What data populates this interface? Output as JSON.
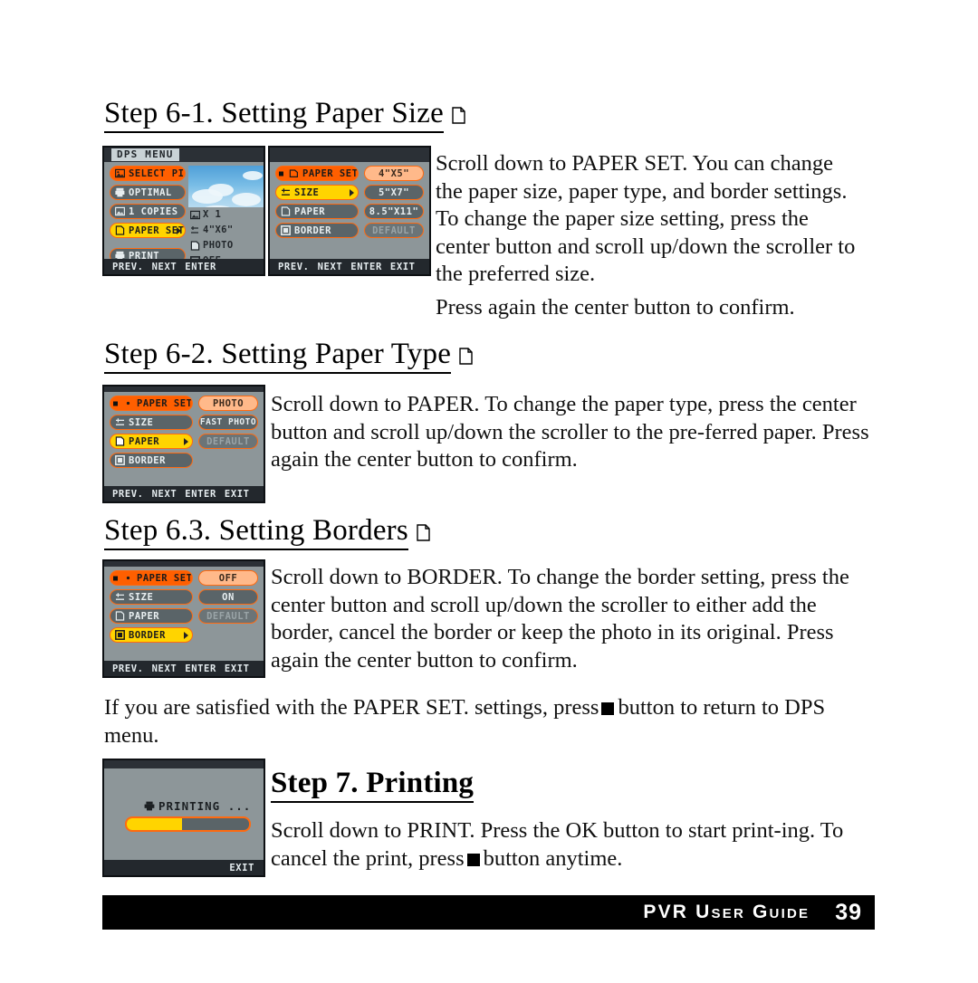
{
  "document": {
    "page_number": "39",
    "footer_label": "PVR User Guide"
  },
  "sections": [
    {
      "heading": "Step 6-1. Setting Paper Size",
      "body": "Scroll down to PAPER SET. You can change the paper size, paper type, and border settings. To change the paper size setting, press the center button and scroll up/down the scroller to the preferred size.",
      "body2": "Press again the center button to confirm."
    },
    {
      "heading": "Step 6-2. Setting Paper Type",
      "body": "Scroll down to PAPER. To change the paper type, press the center button and scroll up/down the scroller to the pre-ferred paper. Press again the center button to confirm."
    },
    {
      "heading": "Step 6.3. Setting Borders",
      "body": "Scroll down to BORDER. To change the border setting, press the center button and scroll up/down the scroller to either add the border, cancel the border or keep the photo in its original. Press again the center button to confirm."
    },
    {
      "heading": "Step 7. Printing",
      "body_pre": "Scroll down to PRINT. Press the OK button to start print-ing. To cancel the print, press",
      "body_post": "button anytime."
    }
  ],
  "interstitial": {
    "pre": "If you are satisfied with the PAPER SET. settings, press",
    "post": "button to return to DPS menu."
  },
  "lcd_footbar": {
    "prev": "PREV.",
    "next": "NEXT",
    "enter": "ENTER",
    "exit": "EXIT"
  },
  "lcd1": {
    "title": "DPS MENU",
    "menu": [
      {
        "label": "SELECT PIC",
        "state": "orange",
        "icon": "picture-icon"
      },
      {
        "label": "OPTIMAL",
        "state": "gray",
        "icon": "printer-icon"
      },
      {
        "label": "1 COPIES",
        "state": "gray",
        "icon": "copies-icon"
      },
      {
        "label": "PAPER SET.",
        "state": "yellow",
        "icon": "paper-icon"
      }
    ],
    "print_button": {
      "label": "PRINT",
      "icon": "printer-icon"
    },
    "info": [
      {
        "label": "X 1",
        "icon": "picture-icon"
      },
      {
        "label": "4\"X6\"",
        "icon": "size-icon"
      },
      {
        "label": "PHOTO",
        "icon": "paper-icon"
      },
      {
        "label": "OFF",
        "icon": "border-icon"
      }
    ]
  },
  "lcd2": {
    "menu": [
      {
        "label": "PAPER SET.",
        "state": "orange",
        "icon": "back-icon"
      },
      {
        "label": "SIZE",
        "state": "yellow",
        "icon": "size-icon"
      },
      {
        "label": "PAPER",
        "state": "gray",
        "icon": "paper-icon"
      },
      {
        "label": "BORDER",
        "state": "gray",
        "icon": "border-icon"
      }
    ],
    "values": [
      {
        "label": "4\"X5\"",
        "state": "peach"
      },
      {
        "label": "5\"X7\"",
        "state": "gray"
      },
      {
        "label": "8.5\"X11\"",
        "state": "gray"
      },
      {
        "label": "DEFAULT",
        "state": "dim"
      }
    ]
  },
  "lcd3": {
    "menu": [
      {
        "label": "PAPER SET.",
        "state": "orange",
        "icon": "back-icon"
      },
      {
        "label": "SIZE",
        "state": "gray",
        "icon": "size-icon"
      },
      {
        "label": "PAPER",
        "state": "yellow",
        "icon": "paper-icon"
      },
      {
        "label": "BORDER",
        "state": "gray",
        "icon": "border-icon"
      }
    ],
    "values": [
      {
        "label": "PHOTO",
        "state": "peach"
      },
      {
        "label": "FAST PHOTO",
        "state": "gray"
      },
      {
        "label": "DEFAULT",
        "state": "dim"
      }
    ]
  },
  "lcd4": {
    "menu": [
      {
        "label": "PAPER SET.",
        "state": "orange",
        "icon": "back-icon"
      },
      {
        "label": "SIZE",
        "state": "gray",
        "icon": "size-icon"
      },
      {
        "label": "PAPER",
        "state": "gray",
        "icon": "paper-icon"
      },
      {
        "label": "BORDER",
        "state": "yellow",
        "icon": "border-icon"
      }
    ],
    "values": [
      {
        "label": "OFF",
        "state": "peach"
      },
      {
        "label": "ON",
        "state": "gray"
      },
      {
        "label": "DEFAULT",
        "state": "dim"
      }
    ]
  },
  "lcd5": {
    "status": "PRINTING ...",
    "progress_percent": 45,
    "exit": "EXIT"
  },
  "colors": {
    "accent_orange": "#ff5f00",
    "highlight_yellow": "#ffd400",
    "pill_border": "#ff6a10",
    "lcd_background": "#8d9699",
    "lcd_chrome": "#23282d"
  }
}
